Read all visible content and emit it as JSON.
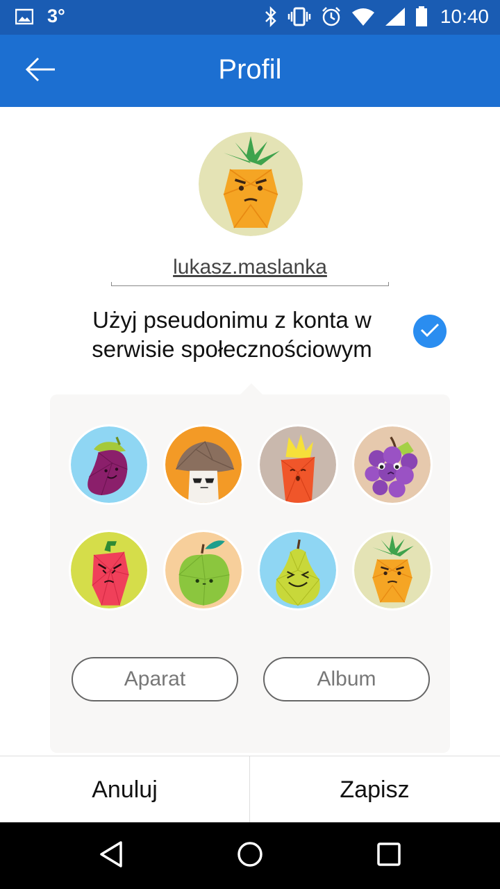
{
  "status_bar": {
    "temperature": "3°",
    "time": "10:40",
    "icons": [
      "image-icon",
      "bluetooth-icon",
      "vibrate-icon",
      "alarm-icon",
      "wifi-icon",
      "signal-icon",
      "battery-icon"
    ]
  },
  "app_bar": {
    "title": "Profil",
    "back_icon": "arrow-left-icon"
  },
  "profile": {
    "selected_avatar": "pineapple",
    "username": "lukasz.maslanka"
  },
  "nickname_option": {
    "label": "Użyj pseudonimu z konta w serwisie społecznościowym",
    "checked": true
  },
  "avatar_picker": {
    "options": [
      "eggplant",
      "mushroom",
      "carrot",
      "grapes",
      "pepper",
      "apple",
      "pear",
      "pineapple"
    ],
    "camera_label": "Aparat",
    "album_label": "Album"
  },
  "actions": {
    "cancel_label": "Anuluj",
    "save_label": "Zapisz"
  },
  "colors": {
    "status_bar": "#1a5cb3",
    "app_bar": "#1c6fd1",
    "check": "#2a8df0"
  },
  "nav_bar": {
    "icons": [
      "back-triangle-icon",
      "home-circle-icon",
      "recents-square-icon"
    ]
  }
}
